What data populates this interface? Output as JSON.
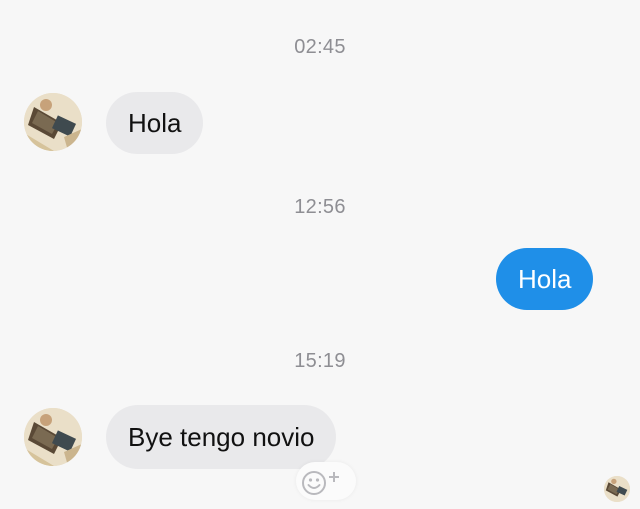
{
  "messages": [
    {
      "time": "02:45",
      "side": "incoming",
      "text": "Hola"
    },
    {
      "time": "12:56",
      "side": "outgoing",
      "text": "Hola"
    },
    {
      "time": "15:19",
      "side": "incoming",
      "text": "Bye tengo novio"
    }
  ],
  "icons": {
    "contact_avatar": "contact-avatar-photo",
    "reaction_button": "smiley-plus-icon",
    "seen_indicator": "seen-avatar-photo"
  },
  "colors": {
    "background": "#f7f7f7",
    "incoming_bubble": "#e9e9eb",
    "outgoing_bubble": "#1f8fe8",
    "timestamp_text": "#8e8e93"
  }
}
